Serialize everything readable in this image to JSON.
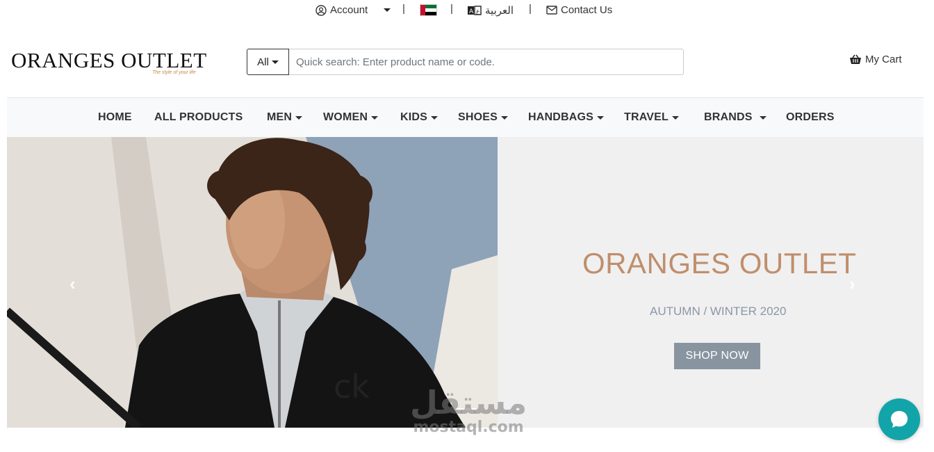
{
  "topbar": {
    "account_label": "Account",
    "language_label": "العربية",
    "contact_label": "Contact Us",
    "separator": "|"
  },
  "logo": {
    "text": "ORANGES OUTLET",
    "tagline": "The style of your life"
  },
  "search": {
    "category": "All",
    "placeholder": "Quick search: Enter product name or code."
  },
  "cart": {
    "label": "My Cart"
  },
  "nav": [
    {
      "label": "HOME",
      "dropdown": false
    },
    {
      "label": "ALL PRODUCTS",
      "dropdown": false
    },
    {
      "label": "MEN",
      "dropdown": true
    },
    {
      "label": "WOMEN",
      "dropdown": true
    },
    {
      "label": "KIDS",
      "dropdown": true
    },
    {
      "label": "SHOES",
      "dropdown": true
    },
    {
      "label": "HANDBAGS",
      "dropdown": true
    },
    {
      "label": "TRAVEL",
      "dropdown": true
    },
    {
      "label": "BRANDS",
      "dropdown": true
    },
    {
      "label": "ORDERS",
      "dropdown": false
    }
  ],
  "hero": {
    "title": "ORANGES OUTLET",
    "subtitle": "AUTUMN / WINTER 2020",
    "cta": "SHOP NOW",
    "prev_icon": "chevron-left-icon",
    "next_icon": "chevron-right-icon"
  },
  "watermark": {
    "arabic": "مستقل",
    "latin": "mostaql.com"
  },
  "colors": {
    "accent_title": "#c08e6c",
    "button_bg": "#8894a0",
    "chat_bg": "#12a4a8",
    "nav_bg": "#f8f9fa"
  }
}
